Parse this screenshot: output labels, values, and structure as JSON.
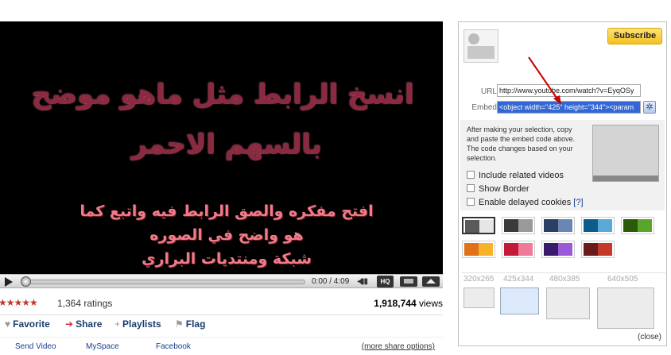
{
  "video": {
    "text_line1": "انسخ الرابط مثل ماهو موضح",
    "text_line2": "بالسهم الاحمر",
    "text_line3": "افتح مفكره والصق الرابط فيه واتبع كما",
    "text_line4": "هو واضح في الصوره",
    "text_line5": "شبكة ومنتديات البراري",
    "text_colors": {
      "heading": "#8a2a40",
      "subtext": "#f07a88"
    }
  },
  "player": {
    "time": "0:00 / 4:09",
    "hq_label": "HQ",
    "progress_fraction": 0.0
  },
  "stats": {
    "stars_rating": 4.5,
    "stars_glyph": "★★★★★",
    "ratings": "1,364 ratings",
    "views_count": "1,918,744",
    "views_suffix": " views"
  },
  "actions": {
    "favorite": "Favorite",
    "share": "Share",
    "playlists": "Playlists",
    "flag": "Flag"
  },
  "share_links": {
    "send_video": "Send Video",
    "myspace": "MySpace",
    "facebook": "Facebook",
    "more": "(more share options)"
  },
  "panel": {
    "subscribe": "Subscribe",
    "url_label": "URL",
    "url_value": "http://www.youtube.com/watch?v=EyqOSy",
    "embed_label": "Embed",
    "embed_value": "<object width=\"425\" height=\"344\"><param",
    "help_text": "After making your selection, copy and paste the embed code above. The code changes based on your selection.",
    "options": {
      "related": "Include related videos",
      "border": "Show Border",
      "cookies": "Enable delayed cookies",
      "cookies_help": "[?]"
    },
    "color_swatches": [
      [
        "#5a5a5a",
        "#e6e6e6"
      ],
      [
        "#3a3a3a",
        "#9a9a9a"
      ],
      [
        "#2b3f63",
        "#6a87b4"
      ],
      [
        "#0b5b8b",
        "#5aa8d8"
      ],
      [
        "#2a5a0a",
        "#5aa62a"
      ],
      [
        "#e0701a",
        "#f7b22a"
      ],
      [
        "#c41a3a",
        "#ef7a9a"
      ],
      [
        "#3a1a6a",
        "#9a5ad8"
      ],
      [
        "#6a1a1a",
        "#c43a2a"
      ]
    ],
    "sizes": [
      "320x265",
      "425x344",
      "480x385",
      "640x505"
    ],
    "close": "(close)",
    "accent_colors": {
      "subscribe": "#f4c11f",
      "embed_selected": "#3367d6",
      "arrow": "#cc0000"
    }
  }
}
